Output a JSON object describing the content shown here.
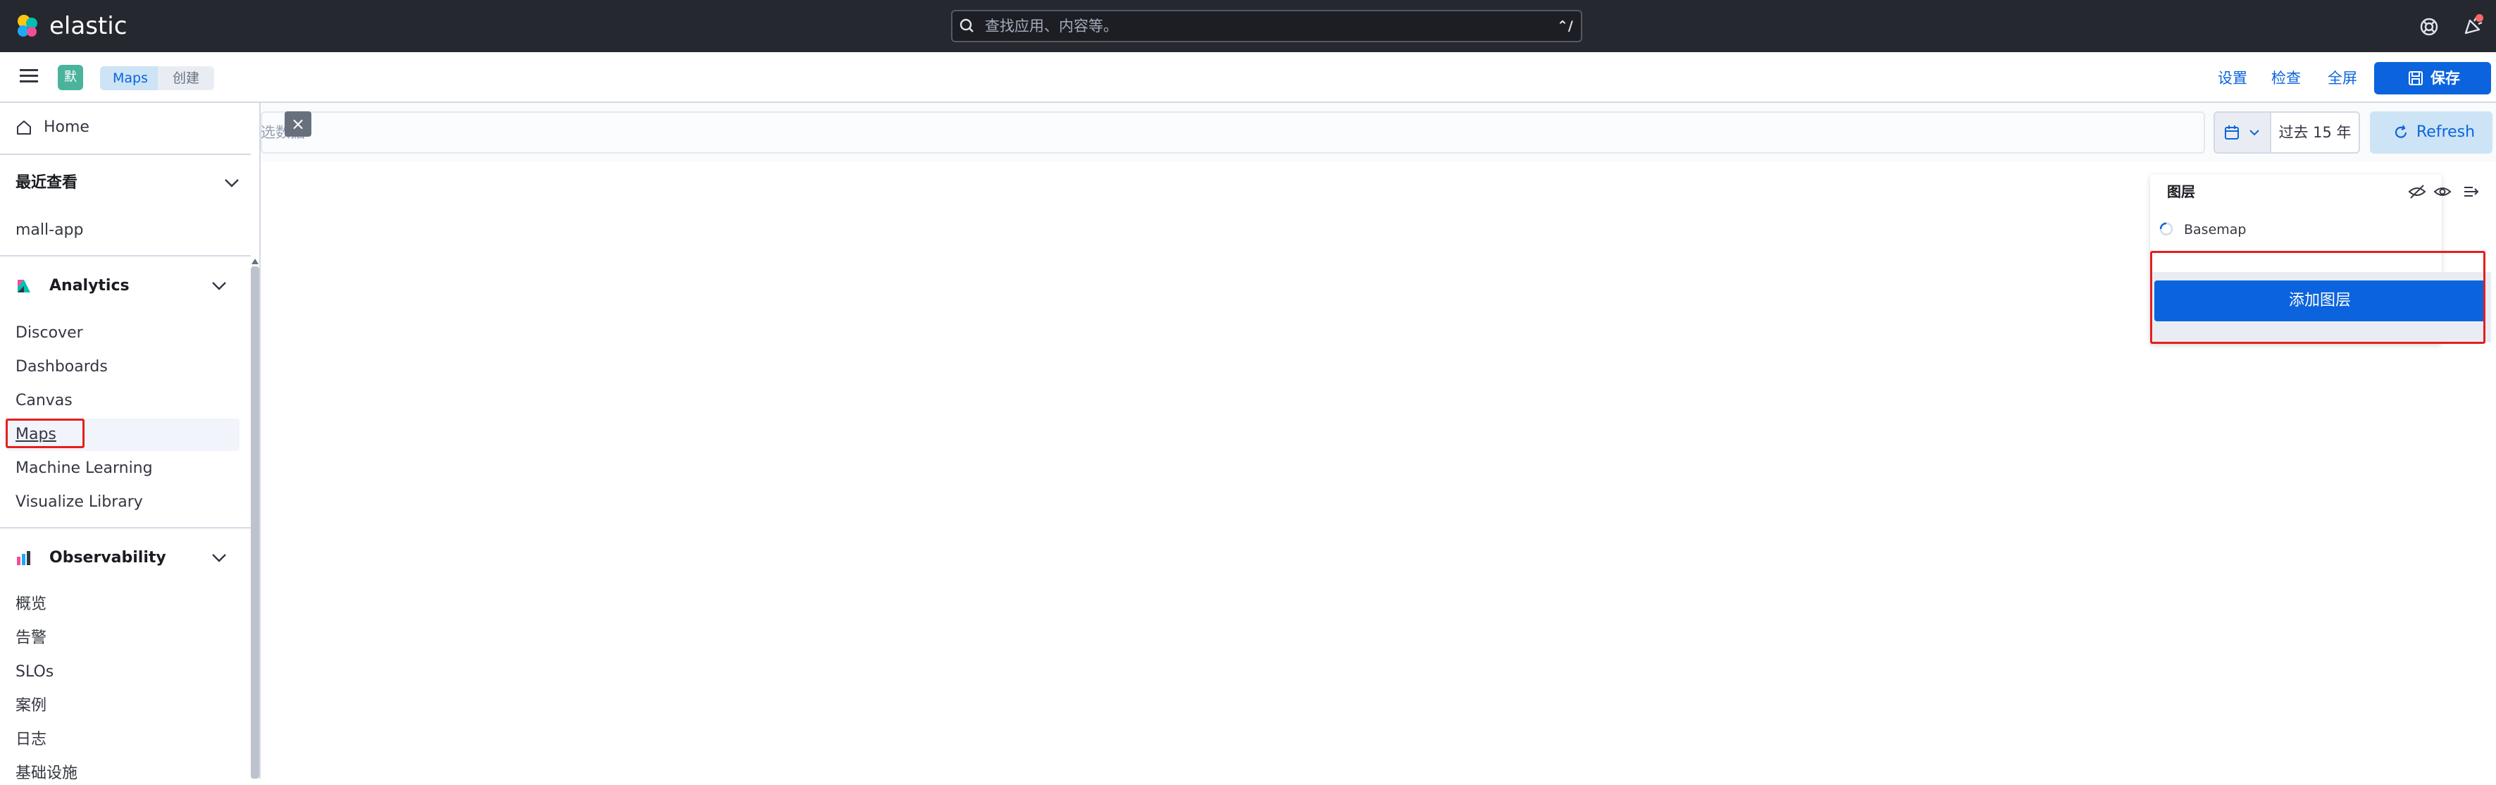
{
  "topbar": {
    "brand": "elastic",
    "search_placeholder": "查找应用、内容等。",
    "search_shortcut": "⌃/"
  },
  "header": {
    "space_avatar": "默",
    "breadcrumbs": [
      "Maps",
      "创建"
    ],
    "links": [
      "设置",
      "检查",
      "全屏"
    ],
    "save_label": "保存"
  },
  "query": {
    "placeholder": "选数据",
    "date_range": "过去 15 年",
    "refresh_label": "Refresh"
  },
  "nav": {
    "home": "Home",
    "recent_header": "最近查看",
    "recent_items": [
      "mall-app"
    ],
    "analytics_header": "Analytics",
    "analytics_items": [
      "Discover",
      "Dashboards",
      "Canvas",
      "Maps",
      "Machine Learning",
      "Visualize Library"
    ],
    "observability_header": "Observability",
    "observability_items": [
      "概览",
      "告警",
      "SLOs",
      "案例",
      "日志",
      "基础设施"
    ]
  },
  "layers": {
    "title": "图层",
    "items": [
      "Basemap"
    ],
    "add_layer_label": "添加图层"
  },
  "colors": {
    "accent": "#0b64dd",
    "highlight": "#e41f1f",
    "topbar": "#25282f"
  }
}
